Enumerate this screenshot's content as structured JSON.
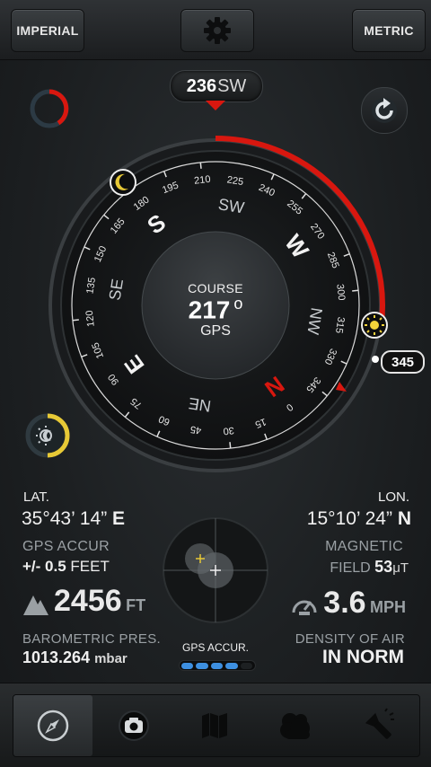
{
  "toolbar": {
    "imperial_label": "IMPERIAL",
    "metric_label": "METRIC",
    "settings_icon": "gear-icon"
  },
  "heading": {
    "degrees": "236",
    "direction": "SW"
  },
  "compass": {
    "course_label": "COURSE",
    "course_value": "217",
    "course_unit": "o",
    "course_source": "GPS",
    "bearing_badge": "345",
    "cardinals": [
      "S",
      "SW",
      "W",
      "NW",
      "N",
      "NE",
      "E",
      "SE"
    ],
    "ticks": [
      "225",
      "240",
      "255",
      "270",
      "285",
      "300",
      "315",
      "330",
      "345",
      "0",
      "15",
      "30",
      "45",
      "60",
      "75",
      "90",
      "105",
      "120",
      "135",
      "150",
      "165",
      "180",
      "195",
      "210"
    ],
    "colors": {
      "accent": "#d8170f",
      "sun": "#f3d33a",
      "moon": "#e7c936"
    }
  },
  "location": {
    "lat_label": "LAT.",
    "lat_value": "35°43’ 14”",
    "lat_hemi": "E",
    "lon_label": "LON.",
    "lon_value": "15°10’ 24”",
    "lon_hemi": "N"
  },
  "gps": {
    "accuracy_label": "GPS  ACCUR",
    "accuracy_value_prefix": "+/-",
    "accuracy_value": "0.5",
    "accuracy_unit": "FEET",
    "accur_caption": "GPS ACCUR.",
    "accur_bars_filled": 4,
    "accur_bars_total": 5
  },
  "magnetic": {
    "label1": "MAGNETIC",
    "label2": "FIELD",
    "value": "53",
    "unit": "μT"
  },
  "altitude": {
    "value": "2456",
    "unit": "FT",
    "icon": "mountain-icon"
  },
  "speed": {
    "value": "3.6",
    "unit": "MPH",
    "icon": "speedometer-icon"
  },
  "barometer": {
    "label": "BAROMETRIC PRES.",
    "value": "1013.264",
    "unit": "mbar"
  },
  "air": {
    "label": "DENSITY OF AIR",
    "value": "IN NORM"
  },
  "nav": [
    {
      "name": "compass-icon"
    },
    {
      "name": "camera-icon"
    },
    {
      "name": "map-icon"
    },
    {
      "name": "weather-icon"
    },
    {
      "name": "flashlight-icon"
    }
  ]
}
